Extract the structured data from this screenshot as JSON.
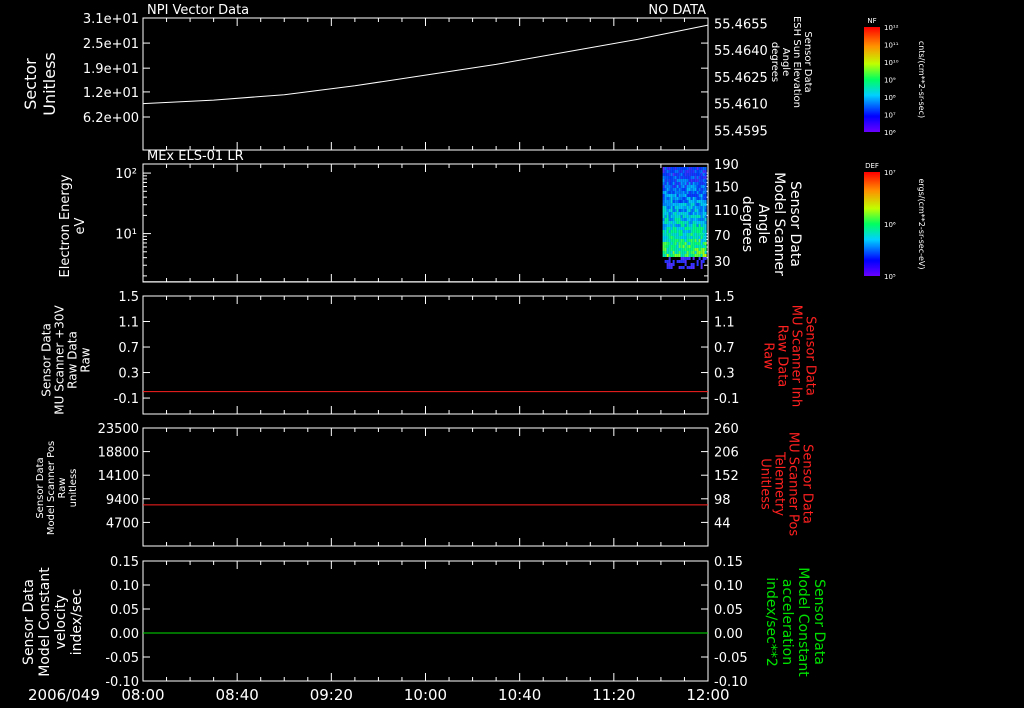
{
  "colors": {
    "background": "#000000",
    "axis": "#ffffff",
    "red_trace": "#ff2020",
    "green_trace": "#00e000",
    "white_trace": "#ffffff"
  },
  "date_label": "2006/049",
  "time_ticks": [
    "08:00",
    "08:40",
    "09:20",
    "10:00",
    "10:40",
    "11:20",
    "12:00"
  ],
  "chart_data": [
    {
      "type": "line",
      "panel_title_left": "NPI Vector Data",
      "panel_title_right": "NO DATA",
      "ylabel_left": [
        "Sector",
        "Unitless"
      ],
      "yticks_left": [
        "3.1e+01",
        "2.5e+01",
        "1.9e+01",
        "1.2e+01",
        "6.2e+00"
      ],
      "ylabel_right": [
        "Sensor Data",
        "ESH Sun Elevation",
        "Angle",
        "degrees"
      ],
      "yticks_right": [
        "55.4655",
        "55.4640",
        "55.4625",
        "55.4610",
        "55.4595"
      ],
      "ylim_right": [
        55.4584,
        55.4658
      ],
      "x": [
        "08:00",
        "08:30",
        "09:00",
        "09:30",
        "10:00",
        "10:30",
        "11:00",
        "11:30",
        "12:00"
      ],
      "values": [
        55.461,
        55.4612,
        55.4615,
        55.462,
        55.4626,
        55.4632,
        55.4639,
        55.4646,
        55.4654
      ],
      "color": "#ffffff"
    },
    {
      "type": "heatmap",
      "panel_title_left": "MEx ELS-01 LR",
      "ylabel_left": [
        "Electron Energy",
        "eV"
      ],
      "yticks_left": [
        "10²",
        "10¹"
      ],
      "ylabel_right": [
        "Sensor Data",
        "Model Scanner",
        "Angle",
        "degrees"
      ],
      "yticks_right": [
        "190",
        "150",
        "110",
        "70",
        "30"
      ],
      "xrange": [
        "11:42",
        "12:00"
      ],
      "baseline_eV": 1.6,
      "colorbar": {
        "label": "DEF",
        "units": "ergs/(cm**2-sr-sec-eV)",
        "ticks": [
          "10⁷",
          "10⁶",
          "10⁵"
        ],
        "range": [
          5,
          7
        ],
        "log": true
      }
    },
    {
      "type": "line",
      "ylabel_left": [
        "Sensor Data",
        "MU Scanner +30V",
        "Raw Data",
        "Raw"
      ],
      "yticks_left": [
        "1.5",
        "1.1",
        "0.7",
        "0.3",
        "-0.1"
      ],
      "ylim": [
        -0.35,
        1.5
      ],
      "ylabel_right": [
        "Sensor Data",
        "MU Scanner Inh",
        "Raw Data",
        "Raw"
      ],
      "yticks_right": [
        "1.5",
        "1.1",
        "0.7",
        "0.3",
        "-0.1"
      ],
      "x": [
        "08:00",
        "12:00"
      ],
      "values": [
        0.0,
        0.0
      ],
      "color": "#ff2020"
    },
    {
      "type": "line",
      "ylabel_left": [
        "Sensor Data",
        "Model Scanner Pos",
        "Raw",
        "unitless"
      ],
      "yticks_left": [
        "23500",
        "18800",
        "14100",
        "9400",
        "4700"
      ],
      "ylim": [
        0,
        23500
      ],
      "ylabel_right": [
        "Sensor Data",
        "MU Scanner Pos",
        "Telemetry",
        "Unitless"
      ],
      "yticks_right": [
        "260",
        "206",
        "152",
        "98",
        "44"
      ],
      "x": [
        "08:00",
        "12:00"
      ],
      "values": [
        8200,
        8200
      ],
      "color": "#ff2020"
    },
    {
      "type": "line",
      "ylabel_left": [
        "Sensor Data",
        "Model Constant",
        "velocity",
        "index/sec"
      ],
      "yticks_left": [
        "0.15",
        "0.10",
        "0.05",
        "0.00",
        "-0.05",
        "-0.10"
      ],
      "ylim": [
        -0.1,
        0.15
      ],
      "ylabel_right": [
        "Sensor Data",
        "Model Constant",
        "acceleration",
        "index/sec**2"
      ],
      "yticks_right": [
        "0.15",
        "0.10",
        "0.05",
        "0.00",
        "-0.05",
        "-0.10"
      ],
      "x": [
        "08:00",
        "12:00"
      ],
      "values": [
        0.0,
        0.0
      ],
      "color": "#00e000"
    }
  ],
  "top_colorbar": {
    "label": "NF",
    "units": "cnts/(cm**2-sr-sec)",
    "ticks": [
      "10¹²",
      "10¹¹",
      "10¹⁰",
      "10⁹",
      "10⁸",
      "10⁷",
      "10⁶"
    ],
    "range": [
      6,
      12
    ],
    "log": true
  }
}
